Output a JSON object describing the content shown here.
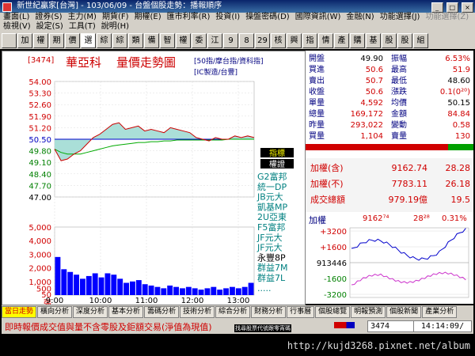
{
  "window": {
    "title": "新世紀贏家[台灣] - 103/06/09 - 台盤個股走勢：播報順序"
  },
  "menu": {
    "row1": [
      "畫面(L)",
      "證券(S)",
      "主力(M)",
      "期貨(F)",
      "期權(E)",
      "匯市利率(R)",
      "投資(I)",
      "操盤密碼(D)",
      "國際資訊(W)",
      "金融(N)",
      "功能選擇(J)"
    ],
    "row1_disabled": [
      "功能選擇(Z)"
    ],
    "row2": [
      "檢視(V)",
      "設定(S)",
      "工具(T)",
      "說明(H)"
    ]
  },
  "toolbar": {
    "buttons": [
      "",
      "加",
      "權",
      "期",
      "價",
      "選",
      "綜",
      "綜",
      "類",
      "備",
      "智",
      "權",
      "委",
      "江",
      "9",
      "8",
      "29",
      "核",
      "興",
      "指",
      "情",
      "產",
      "購",
      "基",
      "股",
      "股",
      "組"
    ]
  },
  "chart": {
    "stock_code": "[3474]",
    "stock_name": "華亞科",
    "chart_title": "量價走勢圖",
    "info_line1": "[50指/摩台指/資科指]",
    "info_line2": "[IC製造/台豐]",
    "price_axis": [
      "54.00",
      "53.30",
      "52.60",
      "51.90",
      "51.20",
      "50.50",
      "49.80",
      "49.10",
      "48.40",
      "47.70",
      "47.00"
    ],
    "volume_axis": [
      "5,000",
      "4,000",
      "3,000",
      "2,000",
      "1,000",
      "500",
      "50",
      "張"
    ],
    "time_axis": [
      "9:00",
      "10:00",
      "11:00",
      "12:00",
      "13:00"
    ],
    "colors": {
      "price_line": "#cc0000",
      "avg_line": "#00aa00",
      "ref_line": "#0000cc",
      "volume": "#0000ff",
      "fill": "#aadfd8"
    }
  },
  "chart_data": {
    "type": "line",
    "series": [
      {
        "values": [
          49.9,
          49.2,
          49.3,
          49.6,
          49.8,
          50.2,
          50.6,
          50.8,
          51.1,
          51.4,
          51.5,
          51.1,
          51.2,
          51.3,
          51.0,
          51.1,
          51.0,
          50.9,
          51.2,
          51.1,
          51.0,
          50.9,
          50.6,
          50.5,
          50.4,
          50.6,
          50.5,
          50.5,
          50.7,
          50.6,
          50.7,
          50.6
        ]
      },
      {
        "values": [
          49.9,
          49.7,
          49.6,
          49.6,
          49.6,
          49.7,
          49.8,
          49.9,
          50.0,
          50.1,
          50.15,
          50.2,
          50.25,
          50.3,
          50.3,
          50.35,
          50.35,
          50.4,
          50.4,
          50.45,
          50.45,
          50.45,
          50.45,
          50.45,
          50.45,
          50.45,
          50.45,
          50.5,
          50.5,
          50.5,
          50.5,
          50.5
        ]
      }
    ],
    "volume": [
      2800,
      1900,
      1700,
      1500,
      1200,
      1400,
      1600,
      1300,
      1600,
      1500,
      1200,
      900,
      1000,
      1100,
      800,
      700,
      600,
      500,
      700,
      600,
      500,
      600,
      500,
      400,
      500,
      600,
      400,
      500,
      600,
      500,
      600,
      900
    ],
    "ylim": [
      47.0,
      54.0
    ],
    "volume_ylim": [
      0,
      5000
    ]
  },
  "quote": {
    "rows": [
      {
        "l": "開盤",
        "v": "49.90",
        "vc": "black",
        "l2": "振幅",
        "v2": "6.53%",
        "v2c": "red"
      },
      {
        "l": "買進",
        "v": "50.6",
        "vc": "red",
        "l2": "最高",
        "v2": "51.9",
        "v2c": "red"
      },
      {
        "l": "賣出",
        "v": "50.7",
        "vc": "red",
        "l2": "最低",
        "v2": "48.60",
        "v2c": "black"
      },
      {
        "l": "收盤",
        "v": "50.6",
        "vc": "red",
        "l2": "漲跌",
        "v2": "0.1(0²⁰)",
        "v2c": "red"
      },
      {
        "l": "單量",
        "v": "4,592",
        "vc": "red",
        "l2": "均價",
        "v2": "50.15",
        "v2c": "black"
      },
      {
        "l": "總量",
        "v": "169,172",
        "vc": "red",
        "l2": "金額",
        "v2": "84.84",
        "v2c": "red"
      },
      {
        "l": "昨量",
        "v": "293,022",
        "vc": "red",
        "l2": "變動",
        "v2": "0.58",
        "v2c": "red"
      },
      {
        "l": "買量",
        "v": "1,104",
        "vc": "red",
        "l2": "賣量",
        "v2": "130",
        "v2c": "red"
      }
    ]
  },
  "brokers": {
    "tabs": [
      "指標",
      "權證"
    ],
    "items": [
      "G2富邦",
      "統一DP",
      "JB元大",
      "凱基MP",
      "2U亞東",
      "F5富邦",
      "JF元大",
      "JF元大",
      "永豐8P",
      "群益7M",
      "群益7L",
      "....."
    ]
  },
  "index": {
    "rows": [
      {
        "l": "加權(含)",
        "v": "9162.74",
        "v2": "28.28"
      },
      {
        "l": "加權(不)",
        "v": "7783.11",
        "v2": "26.18"
      },
      {
        "l": "成交總額",
        "v": "979.19億",
        "v2": "19.5"
      }
    ],
    "mini_label": "加權",
    "mini_value": "9162⁷⁴",
    "mini_change": "28²⁸",
    "mini_percent": "0.31%",
    "mini_axis": [
      "+3200",
      "+1600",
      "913446",
      "-1600",
      "-3200"
    ]
  },
  "tabs": [
    "當日走勢",
    "橫向分析",
    "深度分析",
    "基本分析",
    "籌碼分析",
    "技術分析",
    "綜合分析",
    "財務分析",
    "行事曆",
    "個股總覽",
    "明報預測",
    "個股新聞",
    "產業分析"
  ],
  "status": {
    "message": "即時報價成交值與量不含零股及鉅額交易(淨值為現值)",
    "hint": "找尋股票代號跟零宵碼",
    "code_input": "3474",
    "time": "14:14:09/"
  },
  "watermark": "http://kujd3268.pixnet.net/album"
}
